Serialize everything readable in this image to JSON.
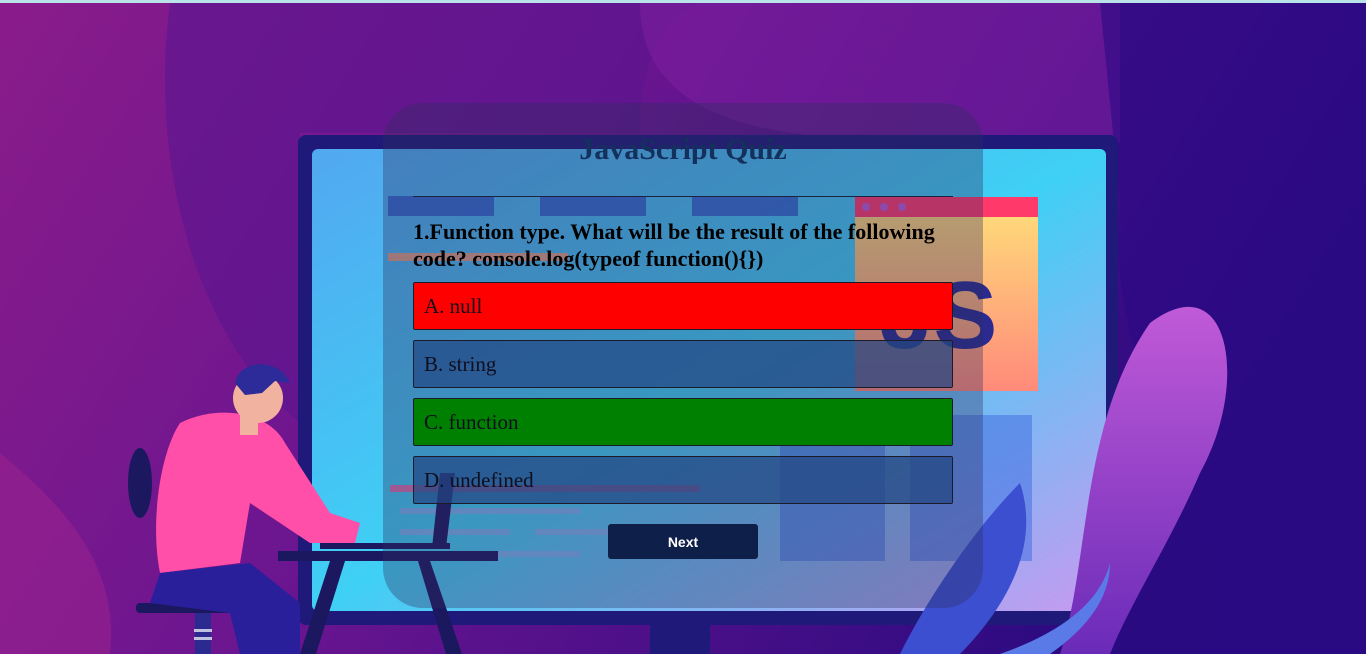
{
  "quiz": {
    "title": "JavaScript Quiz",
    "question": "1.Function type. What will be the result of the following code? console.log(typeof function(){})",
    "answers": [
      {
        "label": "A. null",
        "state": "wrong"
      },
      {
        "label": "B. string",
        "state": "neutral"
      },
      {
        "label": "C. function",
        "state": "correct"
      },
      {
        "label": "D. undefined",
        "state": "neutral"
      }
    ],
    "next_label": "Next"
  },
  "illustration": {
    "badge_text": "JS",
    "colors": {
      "wrong": "#ff0000",
      "correct": "#008000",
      "button": "#0e1f4a",
      "title": "#14315e"
    }
  }
}
